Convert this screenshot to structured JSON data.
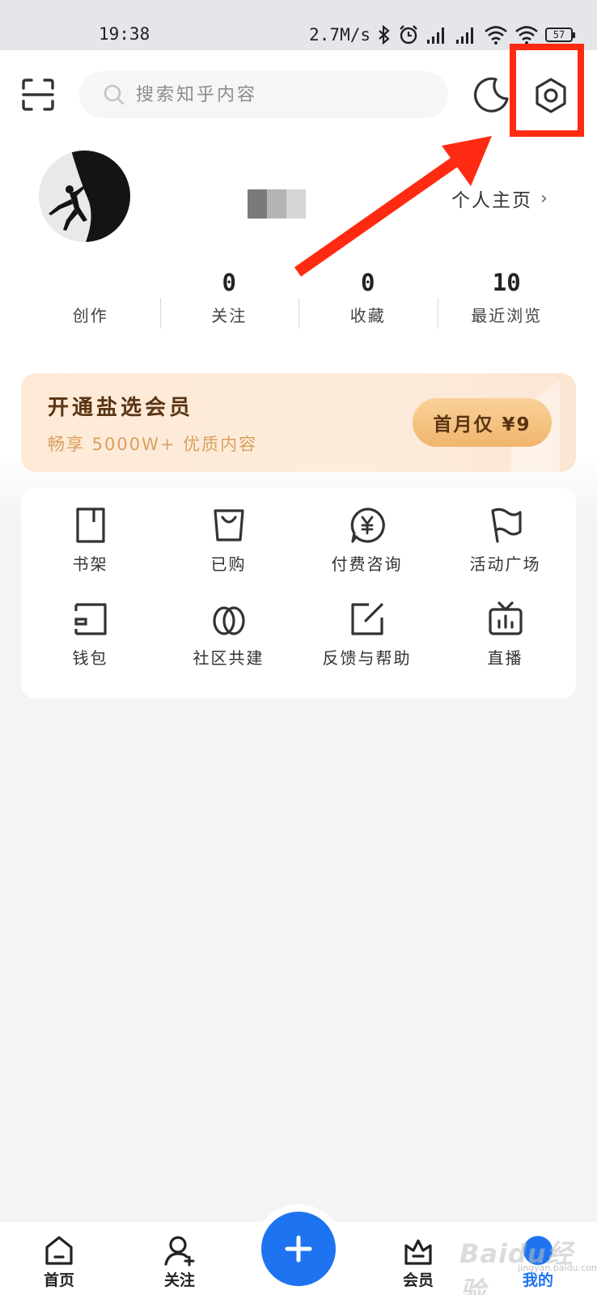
{
  "status_bar": {
    "time": "19:38",
    "speed": "2.7M/s",
    "battery": "57"
  },
  "header": {
    "search_placeholder": "搜索知乎内容",
    "icons": [
      "scan-icon",
      "search-icon",
      "night-mode-icon",
      "settings-icon"
    ]
  },
  "profile": {
    "homepage_link": "个人主页"
  },
  "stats": [
    {
      "value": "",
      "label": "创作"
    },
    {
      "value": "0",
      "label": "关注"
    },
    {
      "value": "0",
      "label": "收藏"
    },
    {
      "value": "10",
      "label": "最近浏览"
    }
  ],
  "vip": {
    "title": "开通盐选会员",
    "subtitle": "畅享 5000W+ 优质内容",
    "button": "首月仅 ¥9"
  },
  "services": [
    {
      "label": "书架",
      "icon": "bookshelf-icon"
    },
    {
      "label": "已购",
      "icon": "shopping-bag-icon"
    },
    {
      "label": "付费咨询",
      "icon": "paid-consult-icon"
    },
    {
      "label": "活动广场",
      "icon": "flag-icon"
    },
    {
      "label": "钱包",
      "icon": "wallet-icon"
    },
    {
      "label": "社区共建",
      "icon": "leaf-icon"
    },
    {
      "label": "反馈与帮助",
      "icon": "edit-icon"
    },
    {
      "label": "直播",
      "icon": "tv-icon"
    }
  ],
  "bottom_nav": {
    "items": [
      {
        "label": "首页",
        "icon": "home-icon"
      },
      {
        "label": "关注",
        "icon": "follow-icon"
      },
      {
        "label": "会员",
        "icon": "vip-crown-icon"
      },
      {
        "label": "我的",
        "icon": "me-icon",
        "active": true
      }
    ],
    "fab_icon": "plus-icon"
  },
  "watermark": {
    "brand": "Baidu经验",
    "url": "jingyan.baidu.com"
  },
  "colors": {
    "accent": "#1e74f0",
    "highlight": "#ff2a12",
    "vip_text": "#5a3413",
    "vip_sub": "#d9a060"
  }
}
